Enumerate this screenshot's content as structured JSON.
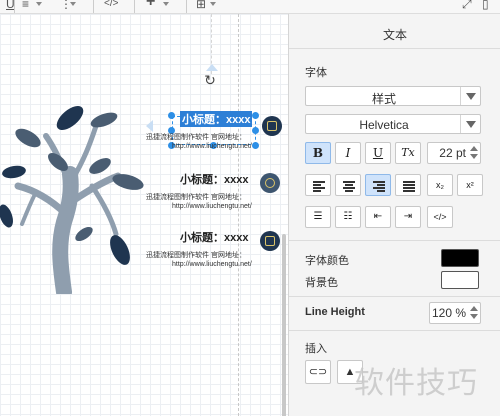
{
  "toolbar": {
    "underline_glyph": "U",
    "align_glyph": "≡",
    "more_glyph": "⋮",
    "code_glyph": "</>",
    "add_glyph": "+",
    "table_glyph": "⊞",
    "fit_glyph": "⤢",
    "menu_glyph": "▯"
  },
  "canvas": {
    "items": [
      {
        "title": "小标题：xxxx",
        "desc1": "迅捷流程图制作软件 官网地址：",
        "desc2": "http://www.liuchengtu.net/"
      },
      {
        "title": "小标题：xxxx",
        "desc1": "迅捷流程图制作软件 官网地址：",
        "desc2": "http://www.liuchengtu.net/"
      },
      {
        "title": "小标题：xxxx",
        "desc1": "迅捷流程图制作软件 官网地址：",
        "desc2": "http://www.liuchengtu.net/"
      }
    ],
    "rotate_glyph": "↻"
  },
  "panel": {
    "title": "文本",
    "font_section": "字体",
    "style_value": "样式",
    "font_value": "Helvetica",
    "bold_label": "B",
    "italic_label": "I",
    "underline_label": "U",
    "clear_label": "Tx",
    "font_size": "22 pt",
    "subscript_label": "x₂",
    "superscript_label": "x²",
    "code_label": "</>",
    "font_color_label": "字体颜色",
    "bg_color_label": "背景色",
    "font_color": "#000000",
    "bg_color": "#ffffff",
    "line_height_label": "Line Height",
    "line_height_value": "120 %",
    "insert_label": "插入",
    "link_glyph": "⊂⊃",
    "image_glyph": "▲"
  },
  "watermark": "软件技巧",
  "colors": {
    "accent": "#2d8fe6",
    "selection_fill": "#2d7fd6",
    "tree": "#4a5d72",
    "leaf_dark": "#1f3550",
    "active_button": "#cfe3fb"
  }
}
